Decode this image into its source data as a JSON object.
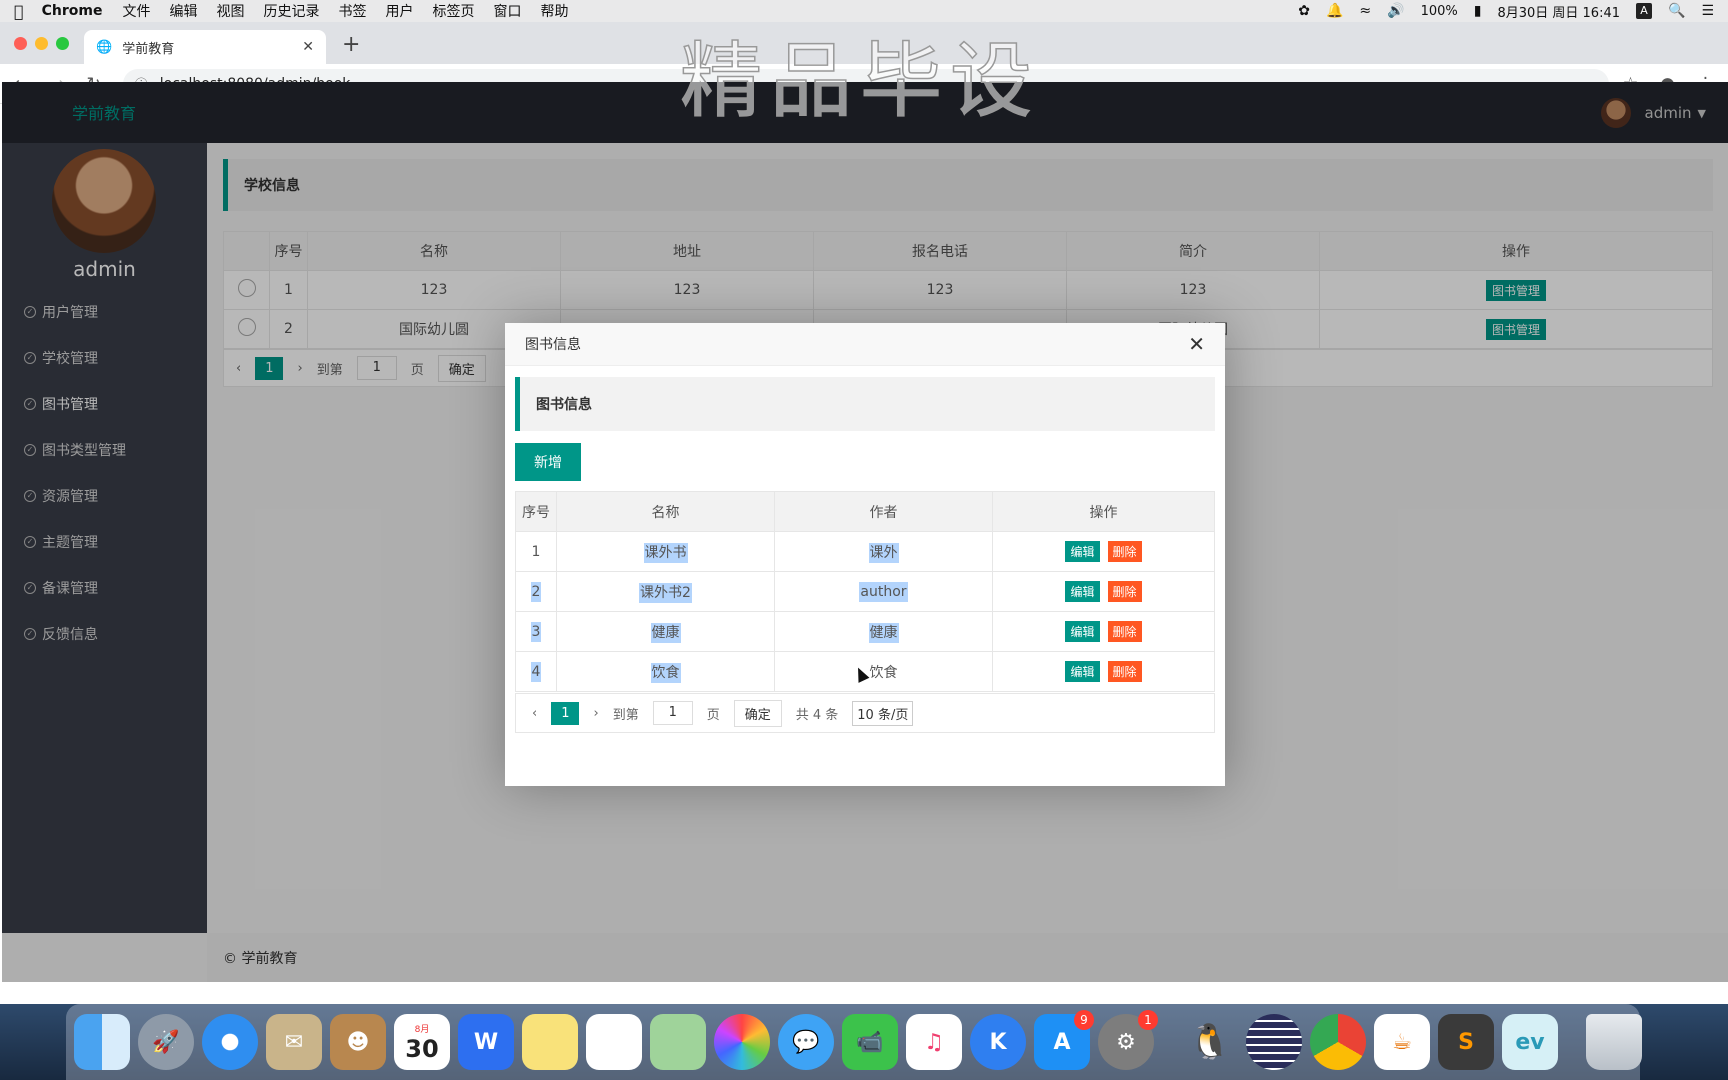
{
  "menubar": {
    "app": "Chrome",
    "menus": [
      "文件",
      "编辑",
      "视图",
      "历史记录",
      "书签",
      "用户",
      "标签页",
      "窗口",
      "帮助"
    ],
    "battery": "100%",
    "datetime": "8月30日 周日  16:41",
    "input_method": "A"
  },
  "browser": {
    "tab_title": "学前教育",
    "url": "localhost:8080/admin/book"
  },
  "watermark": "精品毕设",
  "app": {
    "brand": "学前教育",
    "user": "admin",
    "sidebar_user": "admin",
    "menu": [
      "用户管理",
      "学校管理",
      "图书管理",
      "图书类型管理",
      "资源管理",
      "主题管理",
      "备课管理",
      "反馈信息"
    ],
    "footer": "© 学前教育"
  },
  "school_panel": {
    "title": "学校信息",
    "headers": [
      "序号",
      "名称",
      "地址",
      "报名电话",
      "简介",
      "操作"
    ],
    "rows": [
      {
        "no": "1",
        "name": "123",
        "address": "123",
        "phone": "123",
        "intro": "123",
        "action": "图书管理"
      },
      {
        "no": "2",
        "name": "国际幼儿圆",
        "address": "",
        "phone": "",
        "intro": "国际幼儿圆",
        "action": "图书管理"
      }
    ],
    "pager": {
      "current": "1",
      "goto_label": "到第",
      "page_value": "1",
      "page_unit": "页",
      "confirm": "确定"
    }
  },
  "modal": {
    "title": "图书信息",
    "section_title": "图书信息",
    "add_label": "新增",
    "headers": [
      "序号",
      "名称",
      "作者",
      "操作"
    ],
    "rows": [
      {
        "no": "1",
        "name": "课外书",
        "author": "课外",
        "edit": "编辑",
        "delete": "删除"
      },
      {
        "no": "2",
        "name": "课外书2",
        "author": "author",
        "edit": "编辑",
        "delete": "删除"
      },
      {
        "no": "3",
        "name": "健康",
        "author": "健康",
        "edit": "编辑",
        "delete": "删除"
      },
      {
        "no": "4",
        "name": "饮食",
        "author": "饮食",
        "edit": "编辑",
        "delete": "删除"
      }
    ],
    "pager": {
      "current": "1",
      "goto_label": "到第",
      "page_value": "1",
      "page_unit": "页",
      "confirm": "确定",
      "total": "共 4 条",
      "page_size": "10 条/页"
    }
  },
  "dock": {
    "calendar_month": "8月",
    "calendar_day": "30",
    "appstore_badge": "9",
    "settings_badge": "1"
  }
}
